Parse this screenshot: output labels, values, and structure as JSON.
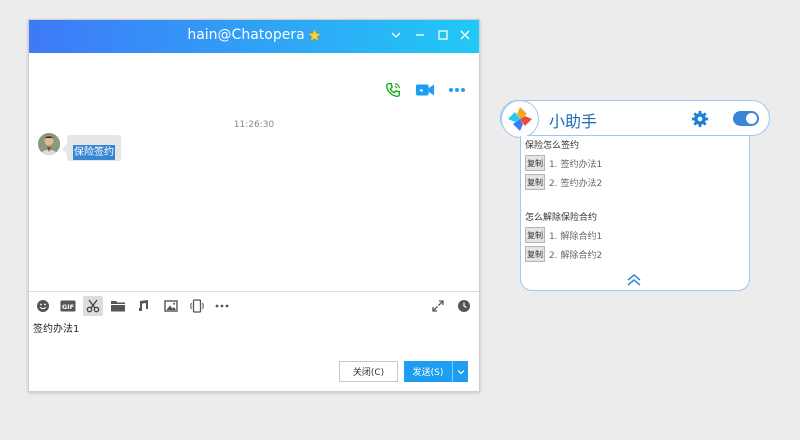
{
  "chat": {
    "title": "hain@Chatopera",
    "timestamp": "11:26:30",
    "message": "保险签约",
    "input_text": "签约办法1",
    "close_label": "关闭(C)",
    "send_label": "发送(S)"
  },
  "assistant": {
    "title": "小助手",
    "toggle_on": true,
    "groups": [
      {
        "question": "保险怎么签约",
        "answers": [
          {
            "copy": "复制",
            "text": "1. 签约办法1"
          },
          {
            "copy": "复制",
            "text": "2. 签约办法2"
          }
        ]
      },
      {
        "question": "怎么解除保险合约",
        "answers": [
          {
            "copy": "复制",
            "text": "1. 解除合约1"
          },
          {
            "copy": "复制",
            "text": "2. 解除合约2"
          }
        ]
      }
    ]
  },
  "colors": {
    "titlebar_start": "#3e79f7",
    "titlebar_end": "#22c8f6",
    "accent": "#1e9ef0",
    "call_icon": "#1aad19",
    "video_icon": "#1e9ef0"
  },
  "icons": {
    "title_badge": "star-icon",
    "toolbar": [
      "emoji-icon",
      "gif-icon",
      "scissors-icon",
      "folder-icon",
      "music-icon",
      "image-icon",
      "shake-icon",
      "more-icon"
    ],
    "right_toolbar": [
      "expand-icon",
      "history-icon"
    ]
  }
}
